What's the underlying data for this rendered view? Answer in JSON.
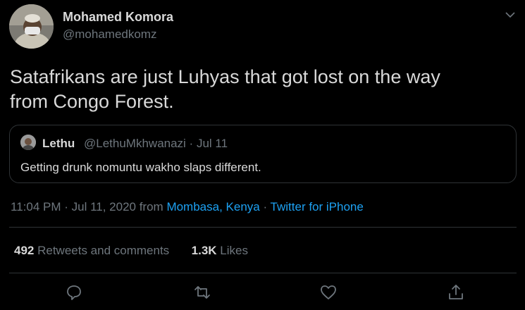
{
  "author": {
    "name": "Mohamed Komora",
    "handle": "@mohamedkomz"
  },
  "tweet": {
    "text_line1": "Satafrikans are just Luhyas that got lost on the way",
    "text_line2": "from Congo Forest."
  },
  "quoted_tweet": {
    "name": "Lethu",
    "handle_date": "@LethuMkhwanazi · Jul 11",
    "text": "Getting drunk nomuntu wakho slaps different."
  },
  "meta": {
    "time_date": "11:04 PM · Jul 11, 2020 from ",
    "location": "Mombasa, Kenya",
    "separator": " · ",
    "source": "Twitter for iPhone"
  },
  "stats": {
    "retweets_count": "492",
    "retweets_label": " Retweets and comments",
    "likes_count": "1.3K",
    "likes_label": " Likes"
  },
  "icons": {
    "more": "chevron-down-icon",
    "reply": "comment-icon",
    "retweet": "retweet-icon",
    "like": "heart-icon",
    "share": "share-icon"
  },
  "colors": {
    "background": "#000000",
    "text": "#d9d9d9",
    "muted": "#6e767d",
    "link": "#1da1f2",
    "border": "#2f3336"
  }
}
